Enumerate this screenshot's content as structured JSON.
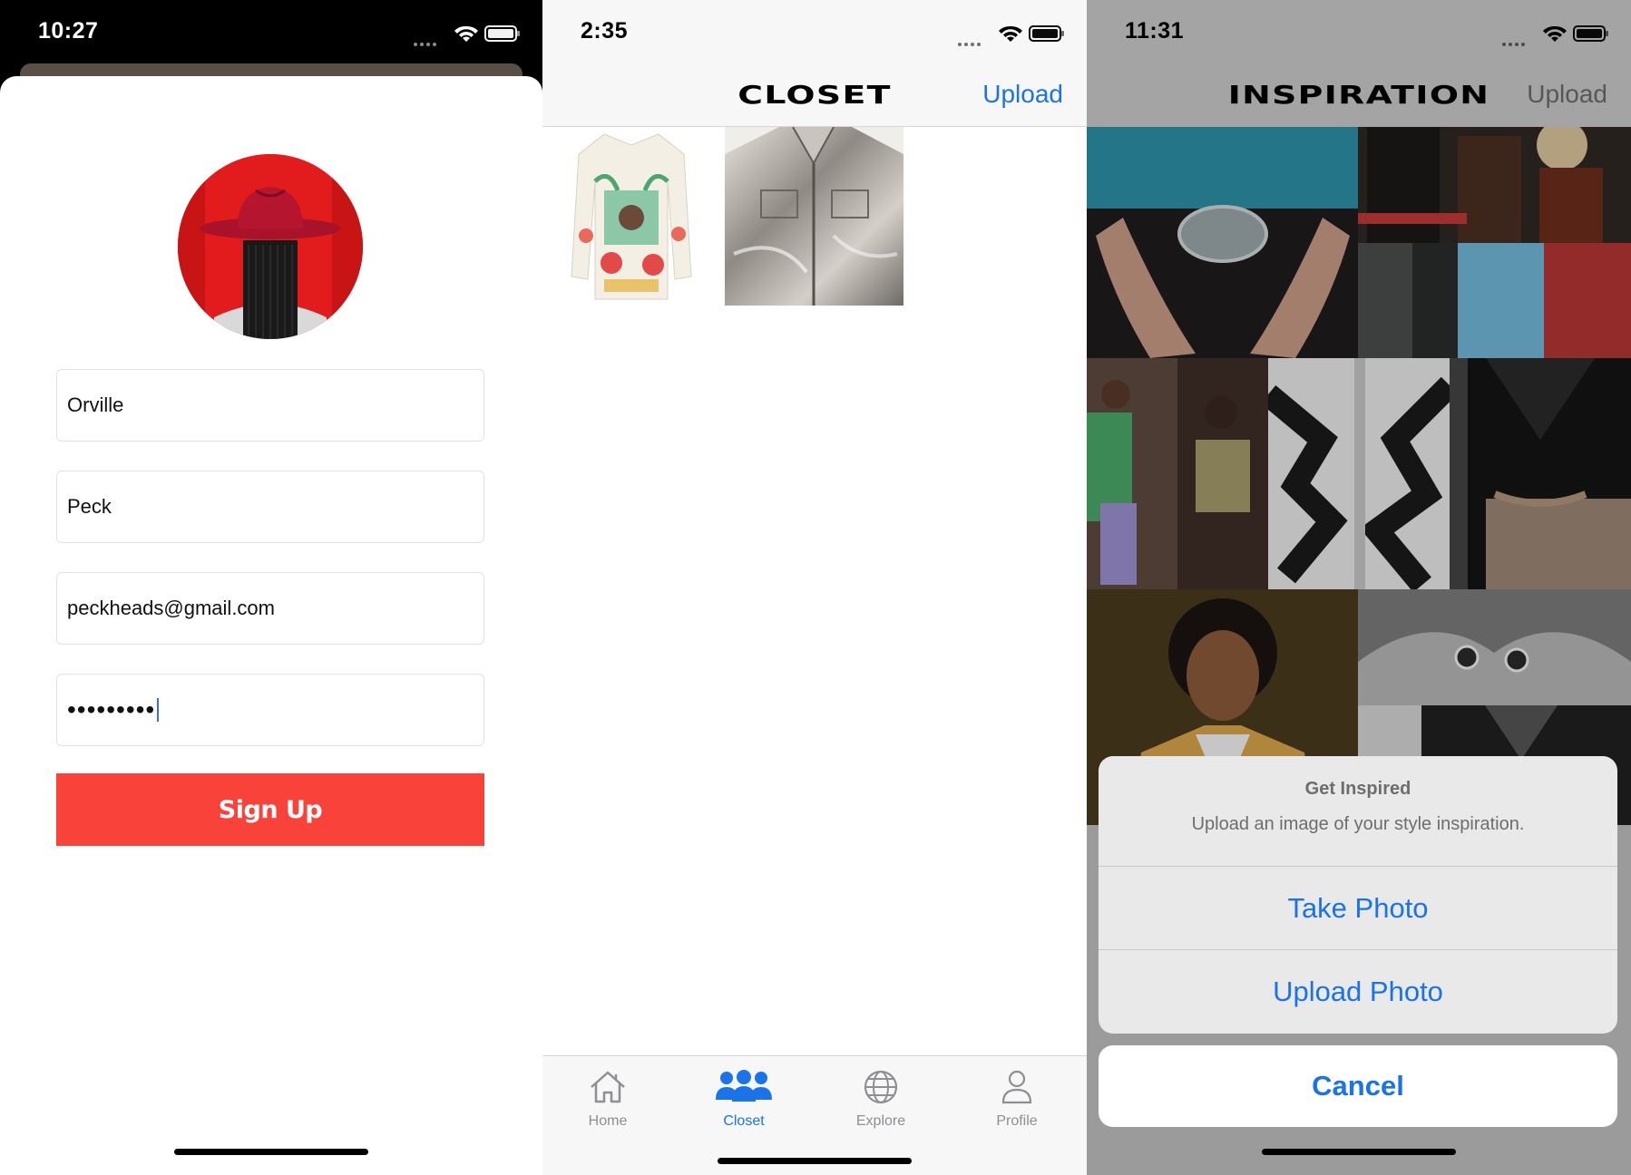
{
  "signup_screen": {
    "status_time": "10:27",
    "first_name": "Orville",
    "last_name": "Peck",
    "email": "peckheads@gmail.com",
    "password_masked": "•••••••••",
    "signup_label": "Sign Up"
  },
  "closet_screen": {
    "status_time": "2:35",
    "title": "CLOSET",
    "upload_label": "Upload",
    "tabs": [
      {
        "label": "Home",
        "icon": "home-icon",
        "active": false
      },
      {
        "label": "Closet",
        "icon": "people-icon",
        "active": true
      },
      {
        "label": "Explore",
        "icon": "globe-icon",
        "active": false
      },
      {
        "label": "Profile",
        "icon": "person-icon",
        "active": false
      }
    ]
  },
  "inspiration_screen": {
    "status_time": "11:31",
    "title": "INSPIRATION",
    "upload_label": "Upload",
    "action_sheet": {
      "title": "Get Inspired",
      "message": "Upload an image of your style inspiration.",
      "take_photo": "Take Photo",
      "upload_photo": "Upload Photo",
      "cancel": "Cancel"
    }
  },
  "colors": {
    "accent_blue": "#1a73e8",
    "signup_red": "#f8423a",
    "avatar_red": "#e61e1e"
  }
}
